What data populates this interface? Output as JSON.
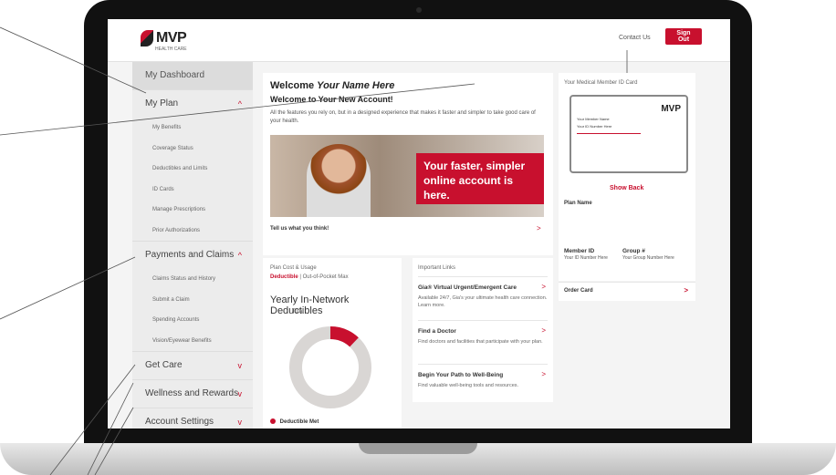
{
  "header": {
    "logo": "MVP",
    "logo_sub": "HEALTH CARE",
    "contact": "Contact Us",
    "signout": "Sign Out"
  },
  "sidebar": {
    "dashboard": "My Dashboard",
    "sections": [
      {
        "label": "My Plan",
        "chevron": "^",
        "items": [
          "My Benefits",
          "Coverage Status",
          "Deductibles and Limits",
          "ID Cards",
          "Manage Prescriptions",
          "Prior Authorizations"
        ]
      },
      {
        "label": "Payments and Claims",
        "chevron": "^",
        "items": [
          "Claims Status and History",
          "Submit a Claim",
          "Spending Accounts",
          "Vision/Eyewear Benefits"
        ]
      },
      {
        "label": "Get Care",
        "chevron": "v",
        "items": []
      },
      {
        "label": "Wellness and Rewards",
        "chevron": "v",
        "items": []
      },
      {
        "label": "Account Settings",
        "chevron": "v",
        "items": []
      }
    ]
  },
  "welcome": {
    "title_prefix": "Welcome",
    "title_name": "Your Name Here",
    "subtitle": "Welcome to Your New Account!",
    "body": "All the features you rely on, but in a designed experience that makes it faster and simpler to take good care of your health.",
    "hero_text": "Your faster, simpler online account is here.",
    "feedback": "Tell us what you think!",
    "feedback_chevron": ">"
  },
  "plan_cost": {
    "header": "Plan Cost & Usage",
    "tab_active": "Deductible",
    "tab_inactive": "Out-of-Pocket Max",
    "title": "Yearly In-Network Deductibles",
    "total_label": "Total",
    "legend": "Deductible Met",
    "met_fraction": 0.12,
    "accent": "#c8102e",
    "track": "#d9d6d4"
  },
  "links": {
    "header": "Important Links",
    "items": [
      {
        "title": "Gia® Virtual Urgent/Emergent Care",
        "desc": "Available 24/7, Gia's your ultimate health care connection. Learn more."
      },
      {
        "title": "Find a Doctor",
        "desc": "Find doctors and facilities that participate with your plan."
      },
      {
        "title": "Begin Your Path to Well-Being",
        "desc": "Find valuable well-being tools and resources."
      }
    ],
    "chevron": ">"
  },
  "id_card": {
    "header": "Your Medical Member ID Card",
    "brand": "MVP",
    "card_line1": "Your Member Name",
    "card_line2": "Your ID Number Here",
    "show_back": "Show Back",
    "plan_name": "Plan Name",
    "member_id_label": "Member ID",
    "member_id_value": "Your ID Number Here",
    "group_label": "Group #",
    "group_value": "Your Group Number Here",
    "order_card": "Order Card",
    "chevron": ">"
  }
}
